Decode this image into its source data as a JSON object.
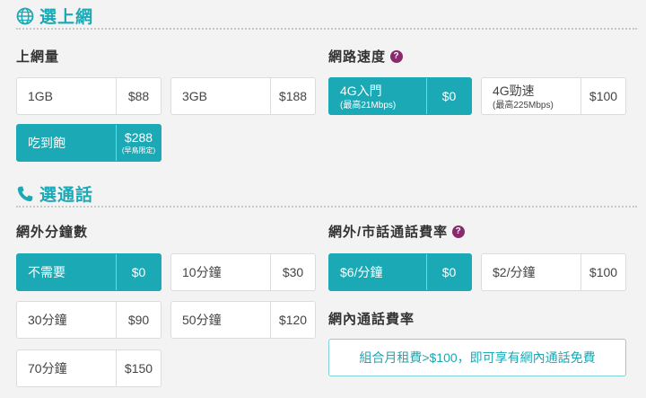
{
  "colors": {
    "accent": "#1aa9b5",
    "help": "#8a2a6e"
  },
  "internet": {
    "icon": "globe-icon",
    "title": "選上網",
    "data_label": "上網量",
    "data_options": [
      {
        "name": "1GB",
        "price": "$88",
        "selected": false
      },
      {
        "name": "3GB",
        "price": "$188",
        "selected": false
      },
      {
        "name": "吃到飽",
        "price": "$288",
        "price_note": "(早鳥限定)",
        "selected": true
      }
    ],
    "speed_label": "網路速度",
    "speed_help": "?",
    "speed_options": [
      {
        "name": "4G入門",
        "note": "(最高21Mbps)",
        "price": "$0",
        "selected": true
      },
      {
        "name": "4G勁速",
        "note": "(最高225Mbps)",
        "price": "$100",
        "selected": false
      }
    ]
  },
  "calls": {
    "icon": "phone-icon",
    "title": "選通話",
    "minutes_label": "網外分鐘數",
    "minutes_options": [
      {
        "name": "不需要",
        "price": "$0",
        "selected": true
      },
      {
        "name": "10分鐘",
        "price": "$30",
        "selected": false
      },
      {
        "name": "30分鐘",
        "price": "$90",
        "selected": false
      },
      {
        "name": "50分鐘",
        "price": "$120",
        "selected": false
      },
      {
        "name": "70分鐘",
        "price": "$150",
        "selected": false
      }
    ],
    "rate_label": "網外/市話通話費率",
    "rate_help": "?",
    "rate_options": [
      {
        "name": "$6/分鐘",
        "price": "$0",
        "selected": true
      },
      {
        "name": "$2/分鐘",
        "price": "$100",
        "selected": false
      }
    ],
    "onnet_label": "網內通話費率",
    "onnet_text": "組合月租費>$100，即可享有網內通話免費"
  }
}
